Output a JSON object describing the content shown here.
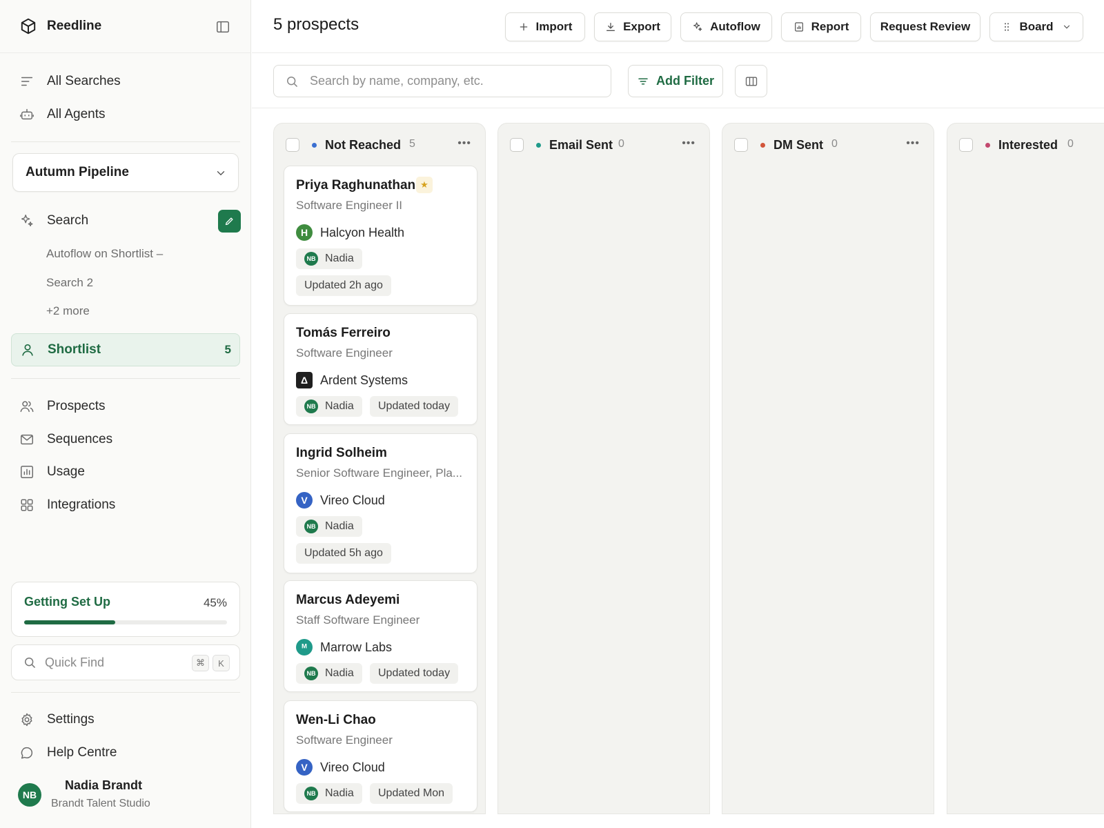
{
  "app": {
    "name": "Reedline"
  },
  "sidebar": {
    "nav_top": [
      {
        "label": "All Searches",
        "icon": "lines-icon"
      },
      {
        "label": "All Agents",
        "icon": "robot-icon"
      }
    ],
    "pipeline": "Autumn Pipeline",
    "search": {
      "label": "Search",
      "items": [
        "Autoflow on Shortlist –",
        "Search 2",
        "+2 more"
      ]
    },
    "shortlist": {
      "label": "Shortlist",
      "count": "5"
    },
    "nav_main": [
      {
        "label": "Prospects",
        "icon": "people-icon"
      },
      {
        "label": "Sequences",
        "icon": "mail-icon"
      },
      {
        "label": "Usage",
        "icon": "chart-icon"
      },
      {
        "label": "Integrations",
        "icon": "grid-icon"
      }
    ],
    "setup": {
      "title": "Getting Set Up",
      "percent_label": "45%",
      "progress": 0.45
    },
    "quick_find": {
      "placeholder": "Quick Find",
      "keys": [
        "⌘",
        "K"
      ]
    },
    "nav_bottom": [
      {
        "label": "Settings",
        "icon": "gear-icon"
      },
      {
        "label": "Help Centre",
        "icon": "chat-icon"
      }
    ],
    "user": {
      "initials": "NB",
      "name": "Nadia Brandt",
      "org": "Brandt Talent Studio"
    }
  },
  "header": {
    "title": "5 prospects",
    "buttons": {
      "import": "Import",
      "export": "Export",
      "autoflow": "Autoflow",
      "report": "Report",
      "request_review": "Request Review",
      "board": "Board"
    }
  },
  "toolbar": {
    "search_placeholder": "Search by name, company, etc.",
    "add_filter": "Add Filter"
  },
  "colors": {
    "accent": "#1f6b43",
    "not_reached": "#3b6fd1",
    "email_sent": "#1f9a8a",
    "dm_sent": "#d2553a",
    "interested": "#c2486e"
  },
  "board": {
    "columns": [
      {
        "title": "Not Reached",
        "count": "5"
      },
      {
        "title": "Email Sent",
        "count": "0"
      },
      {
        "title": "DM Sent",
        "count": "0"
      },
      {
        "title": "Interested",
        "count": "0"
      }
    ],
    "cards": [
      {
        "name": "Priya Raghunathan",
        "starred": true,
        "role": "Software Engineer II",
        "company": "Halcyon Health",
        "company_logo": "H",
        "owner_initials": "NB",
        "owner": "Nadia",
        "updated": "Updated 2h ago"
      },
      {
        "name": "Tomás Ferreiro",
        "role": "Software Engineer",
        "company": "Ardent Systems",
        "company_logo": "Δ",
        "owner_initials": "NB",
        "owner": "Nadia",
        "updated": "Updated today"
      },
      {
        "name": "Ingrid Solheim",
        "role": "Senior Software Engineer, Pla...",
        "company": "Vireo Cloud",
        "company_logo": "V",
        "owner_initials": "NB",
        "owner": "Nadia",
        "updated": "Updated 5h ago"
      },
      {
        "name": "Marcus Adeyemi",
        "role": "Staff Software Engineer",
        "company": "Marrow Labs",
        "company_logo": "ᴹ",
        "owner_initials": "NB",
        "owner": "Nadia",
        "updated": "Updated today"
      },
      {
        "name": "Wen-Li Chao",
        "role": "Software Engineer",
        "company": "Vireo Cloud",
        "company_logo": "V",
        "owner_initials": "NB",
        "owner": "Nadia",
        "updated": "Updated Mon"
      }
    ]
  }
}
